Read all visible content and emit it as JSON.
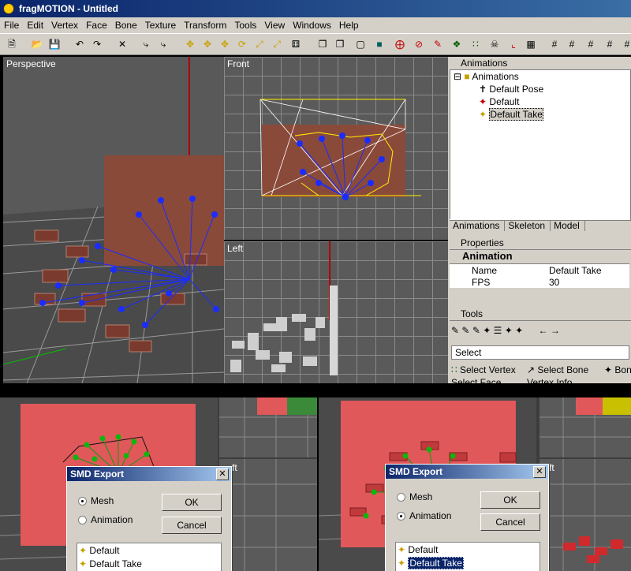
{
  "app": {
    "title": "fragMOTION - Untitled",
    "menus": [
      "File",
      "Edit",
      "Vertex",
      "Face",
      "Bone",
      "Texture",
      "Transform",
      "Tools",
      "View",
      "Windows",
      "Help"
    ]
  },
  "viewports": {
    "perspective": "Perspective",
    "front": "Front",
    "left": "Left"
  },
  "animations_panel": {
    "header": "Animations",
    "root": "Animations",
    "items": [
      "Default Pose",
      "Default",
      "Default Take"
    ],
    "tabs": [
      "Animations",
      "Skeleton",
      "Model"
    ]
  },
  "properties_panel": {
    "header": "Properties",
    "section": "Animation",
    "rows": [
      {
        "key": "Name",
        "value": "Default Take"
      },
      {
        "key": "FPS",
        "value": "30"
      }
    ]
  },
  "tools_panel": {
    "header": "Tools",
    "select_label": "Select",
    "tools": [
      "Select Vertex",
      "Select Bone",
      "Bon",
      "Select Face",
      "Vertex Info"
    ]
  },
  "dialog_left": {
    "title": "SMD Export",
    "mesh_label": "Mesh",
    "animation_label": "Animation",
    "selected_radio": "Mesh",
    "ok": "OK",
    "cancel": "Cancel",
    "list": [
      "Default",
      "Default Take"
    ]
  },
  "dialog_right": {
    "title": "SMD Export",
    "mesh_label": "Mesh",
    "animation_label": "Animation",
    "selected_radio": "Animation",
    "ok": "OK",
    "cancel": "Cancel",
    "list": [
      "Default",
      "Default Take"
    ],
    "selected_item": "Default Take"
  },
  "bottom_pane_labels": [
    "ft",
    "ft"
  ]
}
